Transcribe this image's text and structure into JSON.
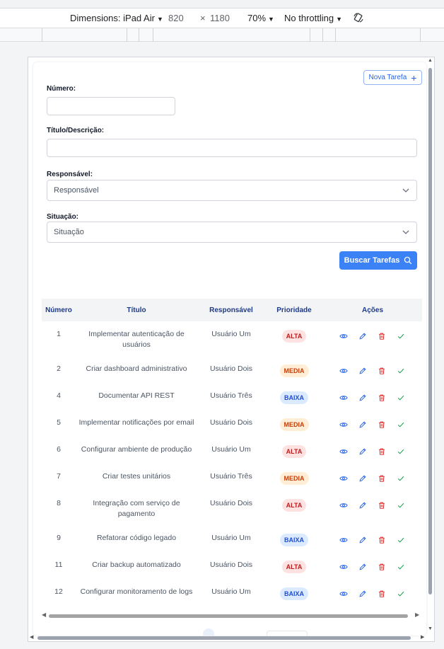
{
  "devtools": {
    "dimensions_label": "Dimensions: iPad Air",
    "width": "820",
    "times": "×",
    "height": "1180",
    "zoom": "70%",
    "throttling": "No throttling"
  },
  "header": {
    "new_task_label": "Nova Tarefa"
  },
  "filters": {
    "numero_label": "Número:",
    "numero_value": "",
    "titulo_label": "Título/Descrição:",
    "titulo_value": "",
    "responsavel_label": "Responsável:",
    "responsavel_selected": "Responsável",
    "situacao_label": "Situação:",
    "situacao_selected": "Situação",
    "search_label": "Buscar Tarefas"
  },
  "table": {
    "columns": [
      "Número",
      "Título",
      "Responsável",
      "Prioridade",
      "Ações"
    ],
    "rows": [
      {
        "numero": "1",
        "titulo": "Implementar autenticação de usuários",
        "responsavel": "Usuário Um",
        "prioridade": "ALTA"
      },
      {
        "numero": "2",
        "titulo": "Criar dashboard administrativo",
        "responsavel": "Usuário Dois",
        "prioridade": "MEDIA"
      },
      {
        "numero": "4",
        "titulo": "Documentar API REST",
        "responsavel": "Usuário Três",
        "prioridade": "BAIXA"
      },
      {
        "numero": "5",
        "titulo": "Implementar notificações por email",
        "responsavel": "Usuário Dois",
        "prioridade": "MEDIA"
      },
      {
        "numero": "6",
        "titulo": "Configurar ambiente de produção",
        "responsavel": "Usuário Um",
        "prioridade": "ALTA"
      },
      {
        "numero": "7",
        "titulo": "Criar testes unitários",
        "responsavel": "Usuário Três",
        "prioridade": "MEDIA"
      },
      {
        "numero": "8",
        "titulo": "Integração com serviço de pagamento",
        "responsavel": "Usuário Dois",
        "prioridade": "ALTA"
      },
      {
        "numero": "9",
        "titulo": "Refatorar código legado",
        "responsavel": "Usuário Um",
        "prioridade": "BAIXA"
      },
      {
        "numero": "11",
        "titulo": "Criar backup automatizado",
        "responsavel": "Usuário Dois",
        "prioridade": "ALTA"
      },
      {
        "numero": "12",
        "titulo": "Configurar monitoramento de logs",
        "responsavel": "Usuário Um",
        "prioridade": "BAIXA"
      }
    ]
  },
  "icons": {
    "new_task": "plus-icon",
    "search": "search-icon",
    "dropdown": "chevron-down-icon",
    "row_actions": [
      "eye-icon",
      "pencil-icon",
      "trash-icon",
      "check-icon"
    ]
  },
  "colors": {
    "primary": "#3b82f6",
    "header_text": "#1e3a8a",
    "alta_bg": "#fee2e2",
    "alta_fg": "#b91c1c",
    "media_bg": "#ffedd5",
    "media_fg": "#c2410c",
    "baixa_bg": "#dbeafe",
    "baixa_fg": "#1d4ed8",
    "view_icon": "#2563eb",
    "edit_icon": "#2563eb",
    "delete_icon": "#dc2626",
    "complete_icon": "#16a34a"
  }
}
